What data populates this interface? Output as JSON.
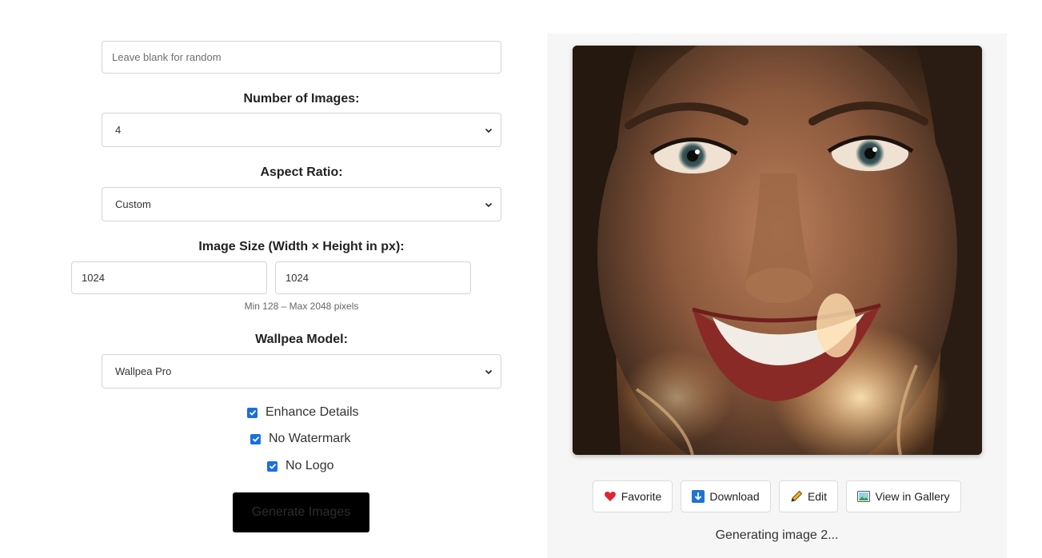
{
  "form": {
    "seed_placeholder": "Leave blank for random",
    "num_images_label": "Number of Images:",
    "num_images_value": "4",
    "aspect_label": "Aspect Ratio:",
    "aspect_value": "Custom",
    "size_label": "Image Size (Width × Height in px):",
    "width_value": "1024",
    "height_value": "1024",
    "size_hint": "Min 128 – Max 2048 pixels",
    "model_label": "Wallpea Model:",
    "model_value": "Wallpea Pro",
    "checkboxes": [
      {
        "label": "Enhance Details",
        "checked": true
      },
      {
        "label": "No Watermark",
        "checked": true
      },
      {
        "label": "No Logo",
        "checked": true
      }
    ],
    "generate_label": "Generate Images"
  },
  "result": {
    "actions": [
      {
        "label": "Favorite",
        "icon": "heart-icon"
      },
      {
        "label": "Download",
        "icon": "download-icon"
      },
      {
        "label": "Edit",
        "icon": "pencil-icon"
      },
      {
        "label": "View in Gallery",
        "icon": "picture-icon"
      }
    ],
    "status": "Generating image 2..."
  },
  "colors": {
    "checkbox": "#1a6fe0",
    "button_bg": "#000000",
    "panel_bg": "#f6f6f6"
  }
}
